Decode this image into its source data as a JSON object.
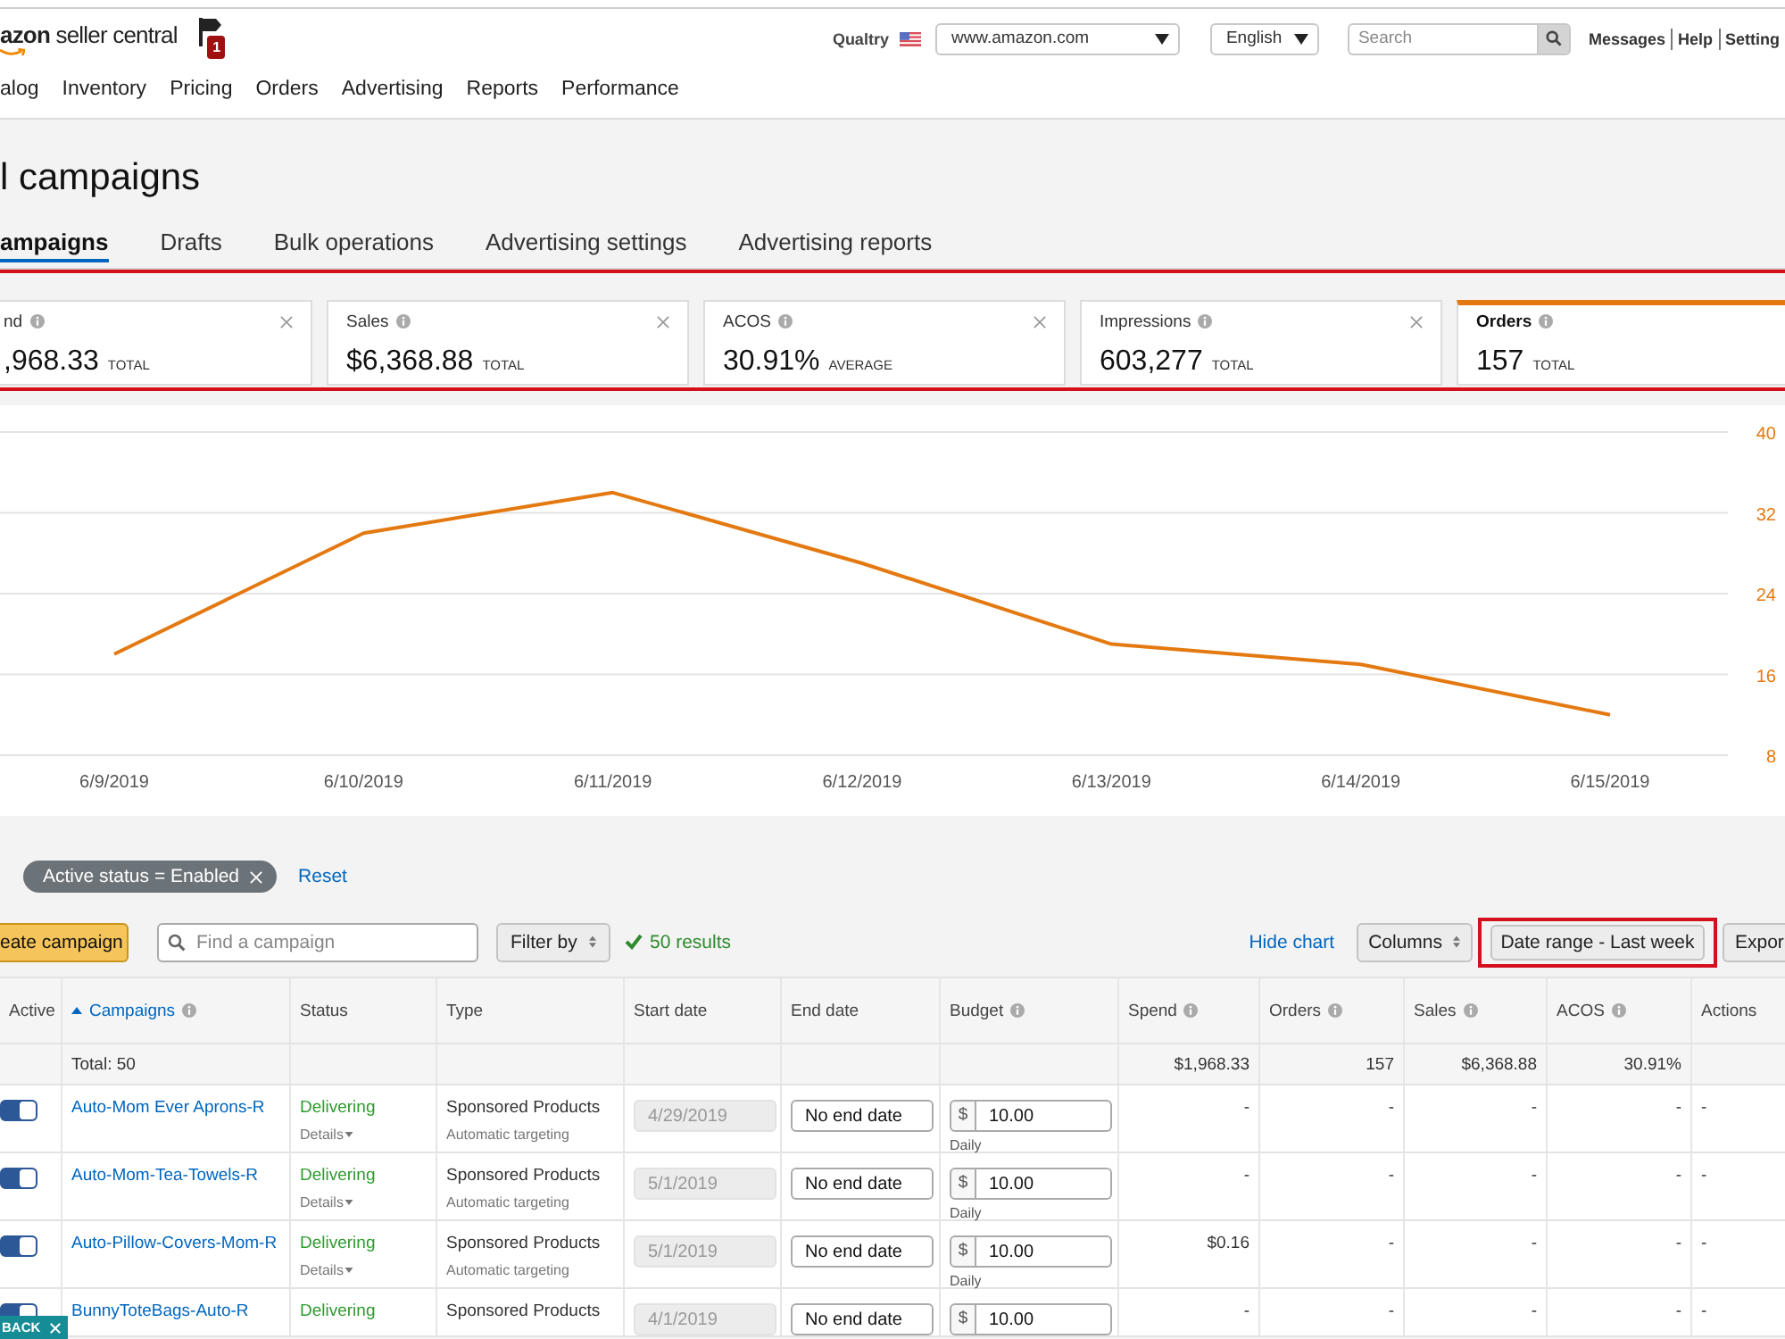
{
  "header": {
    "logo": "**azon** seller central",
    "notifications": "1",
    "store": "Qualtry",
    "marketplace": "www.amazon.com",
    "language": "English",
    "search": {
      "placeholder": "Search"
    },
    "links": [
      "Messages",
      "Help",
      "Setting"
    ],
    "nav": [
      "alog",
      "Inventory",
      "Pricing",
      "Orders",
      "Advertising",
      "Reports",
      "Performance"
    ]
  },
  "page": {
    "title": "l campaigns",
    "tabs": [
      {
        "label": "ampaigns",
        "selected": true
      },
      {
        "label": "Drafts",
        "selected": false
      },
      {
        "label": "Bulk operations",
        "selected": false
      },
      {
        "label": "Advertising settings",
        "selected": false
      },
      {
        "label": "Advertising reports",
        "selected": false
      }
    ]
  },
  "metrics": {
    "highlighted": true,
    "cards": [
      {
        "label": "nd",
        "value": ",968.33",
        "unit": "TOTAL",
        "selected": false
      },
      {
        "label": "Sales",
        "value": "$6,368.88",
        "unit": "TOTAL",
        "selected": false
      },
      {
        "label": "ACOS",
        "value": "30.91%",
        "unit": "AVERAGE",
        "selected": false
      },
      {
        "label": "Impressions",
        "value": "603,277",
        "unit": "TOTAL",
        "selected": false
      },
      {
        "label": "Orders",
        "value": "157",
        "unit": "TOTAL",
        "selected": true
      }
    ]
  },
  "chart": {
    "chart_data": {
      "type": "line",
      "categories": [
        "6/9/2019",
        "6/10/2019",
        "6/11/2019",
        "6/12/2019",
        "6/13/2019",
        "6/14/2019",
        "6/15/2019"
      ],
      "series": [
        {
          "color": "#e47911",
          "values": [
            18,
            30,
            34,
            27,
            19,
            17,
            12
          ]
        }
      ],
      "ylim": [
        8,
        40
      ],
      "yticks": [
        8,
        16,
        24,
        32,
        40
      ],
      "grid": true
    }
  },
  "filters": {
    "chips": [
      {
        "label": "Active status = Enabled"
      }
    ],
    "reset": "Reset"
  },
  "toolbar": {
    "create": "eate campaign",
    "search": {
      "placeholder": "Find a campaign"
    },
    "filter_by": "Filter by",
    "results": "50 results",
    "hide_chart": "Hide chart",
    "columns": "Columns",
    "date_range": {
      "label": "Date range - Last week",
      "highlighted": true
    },
    "export": "Expor"
  },
  "table": {
    "columns": [
      {
        "label": "Active",
        "sorted": false,
        "info": false
      },
      {
        "label": "Campaigns",
        "sorted": true,
        "info": true
      },
      {
        "label": "Status",
        "sorted": false,
        "info": false
      },
      {
        "label": "Type",
        "sorted": false,
        "info": false
      },
      {
        "label": "Start date",
        "sorted": false,
        "info": false
      },
      {
        "label": "End date",
        "sorted": false,
        "info": false
      },
      {
        "label": "Budget",
        "sorted": false,
        "info": true
      },
      {
        "label": "Spend",
        "sorted": false,
        "info": true
      },
      {
        "label": "Orders",
        "sorted": false,
        "info": true
      },
      {
        "label": "Sales",
        "sorted": false,
        "info": true
      },
      {
        "label": "ACOS",
        "sorted": false,
        "info": true
      },
      {
        "label": "Actions",
        "sorted": false,
        "info": false
      }
    ],
    "total": {
      "label": "Total: 50",
      "spend": "$1,968.33",
      "orders": "157",
      "sales": "$6,368.88",
      "acos": "30.91%"
    },
    "rows": [
      {
        "active": true,
        "name": "Auto-Mom Ever Aprons-R",
        "status": "Delivering",
        "details": "Details",
        "type": "Sponsored Products",
        "targeting": "Automatic targeting",
        "start_date": {
          "value": "4/29/2019",
          "disabled": true
        },
        "end_date": "No end date",
        "budget": {
          "currency": "$",
          "value": "10.00",
          "period": "Daily"
        },
        "spend": "-",
        "orders": "-",
        "sales": "-",
        "acos": "-",
        "actions": "-"
      },
      {
        "active": true,
        "name": "Auto-Mom-Tea-Towels-R",
        "status": "Delivering",
        "details": "Details",
        "type": "Sponsored Products",
        "targeting": "Automatic targeting",
        "start_date": {
          "value": "5/1/2019",
          "disabled": true
        },
        "end_date": "No end date",
        "budget": {
          "currency": "$",
          "value": "10.00",
          "period": "Daily"
        },
        "spend": "-",
        "orders": "-",
        "sales": "-",
        "acos": "-",
        "actions": "-"
      },
      {
        "active": true,
        "name": "Auto-Pillow-Covers-Mom-R",
        "status": "Delivering",
        "details": "Details",
        "type": "Sponsored Products",
        "targeting": "Automatic targeting",
        "start_date": {
          "value": "5/1/2019",
          "disabled": true
        },
        "end_date": "No end date",
        "budget": {
          "currency": "$",
          "value": "10.00",
          "period": "Daily"
        },
        "spend": "$0.16",
        "orders": "-",
        "sales": "-",
        "acos": "-",
        "actions": "-"
      },
      {
        "active": true,
        "name": "BunnyToteBags-Auto-R",
        "status": "Delivering",
        "type": "Sponsored Products",
        "start_date": {
          "value": "4/1/2019",
          "disabled": true
        },
        "end_date": "No end date",
        "budget": {
          "currency": "$",
          "value": "10.00"
        },
        "spend": "-",
        "orders": "-",
        "sales": "-",
        "acos": "-",
        "actions": "-"
      }
    ]
  },
  "feedback": {
    "label": "BACK"
  }
}
